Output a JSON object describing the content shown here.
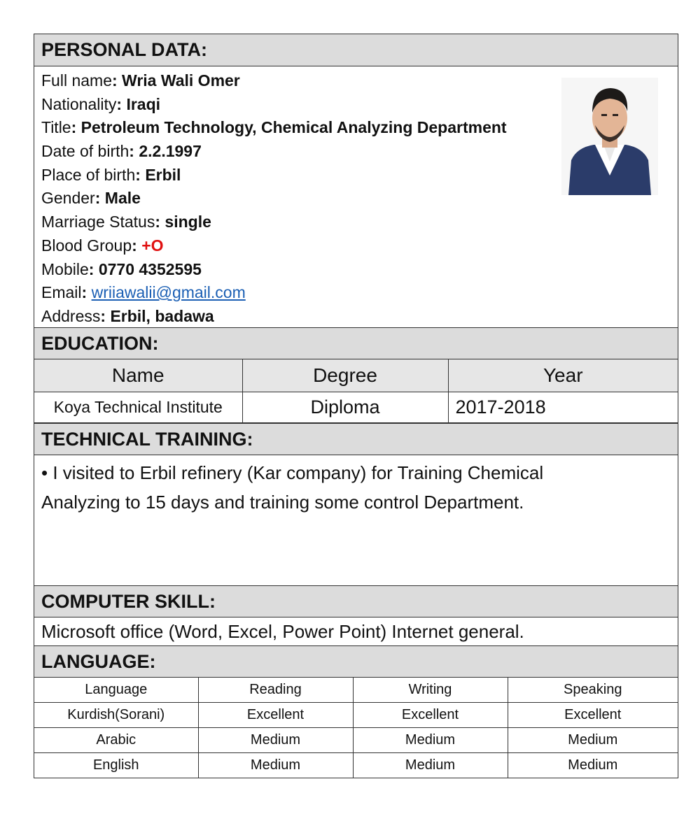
{
  "personal": {
    "heading": "PERSONAL DATA:",
    "fields": [
      {
        "label": "Full name",
        "value": "Wria Wali Omer"
      },
      {
        "label": "Nationality",
        "value": "Iraqi"
      },
      {
        "label": "Title",
        "value": "Petroleum Technology, Chemical Analyzing Department"
      },
      {
        "label": "Date of birth",
        "value": "2.2.1997"
      },
      {
        "label": "Place of birth",
        "value": "Erbil"
      },
      {
        "label": "Gender",
        "value": "Male"
      },
      {
        "label": "Marriage Status",
        "value": "single"
      },
      {
        "label": "Blood Group",
        "value": "+O"
      },
      {
        "label": "Mobile",
        "value": "0770 4352595"
      },
      {
        "label": "Email",
        "value": "wriiawalii@gmail.com"
      },
      {
        "label": "Address",
        "value": "Erbil, badawa"
      }
    ],
    "colors": {
      "blood_group": "#e01010",
      "email_link": "#1b5fb4"
    }
  },
  "education": {
    "heading": "EDUCATION:",
    "columns": [
      "Name",
      "Degree",
      "Year"
    ],
    "rows": [
      [
        "Koya Technical Institute",
        "Diploma",
        "2017-2018"
      ]
    ]
  },
  "training": {
    "heading": "TECHNICAL TRAINING:",
    "line1": "• I visited to Erbil refinery (Kar  company) for Training Chemical",
    "line2": "Analyzing to 15 days and training some control  Department."
  },
  "computer": {
    "heading": "COMPUTER SKILL:",
    "text": "Microsoft office (Word, Excel, Power Point) Internet general."
  },
  "language": {
    "heading": "LANGUAGE:",
    "columns": [
      "Language",
      "Reading",
      "Writing",
      "Speaking"
    ],
    "rows": [
      [
        "Kurdish(Sorani)",
        "Excellent",
        "Excellent",
        "Excellent"
      ],
      [
        "Arabic",
        "Medium",
        "Medium",
        "Medium"
      ],
      [
        "English",
        "Medium",
        "Medium",
        "Medium"
      ]
    ]
  },
  "colors": {
    "section_header_bg": "#dcdcdc",
    "border": "#333333"
  }
}
